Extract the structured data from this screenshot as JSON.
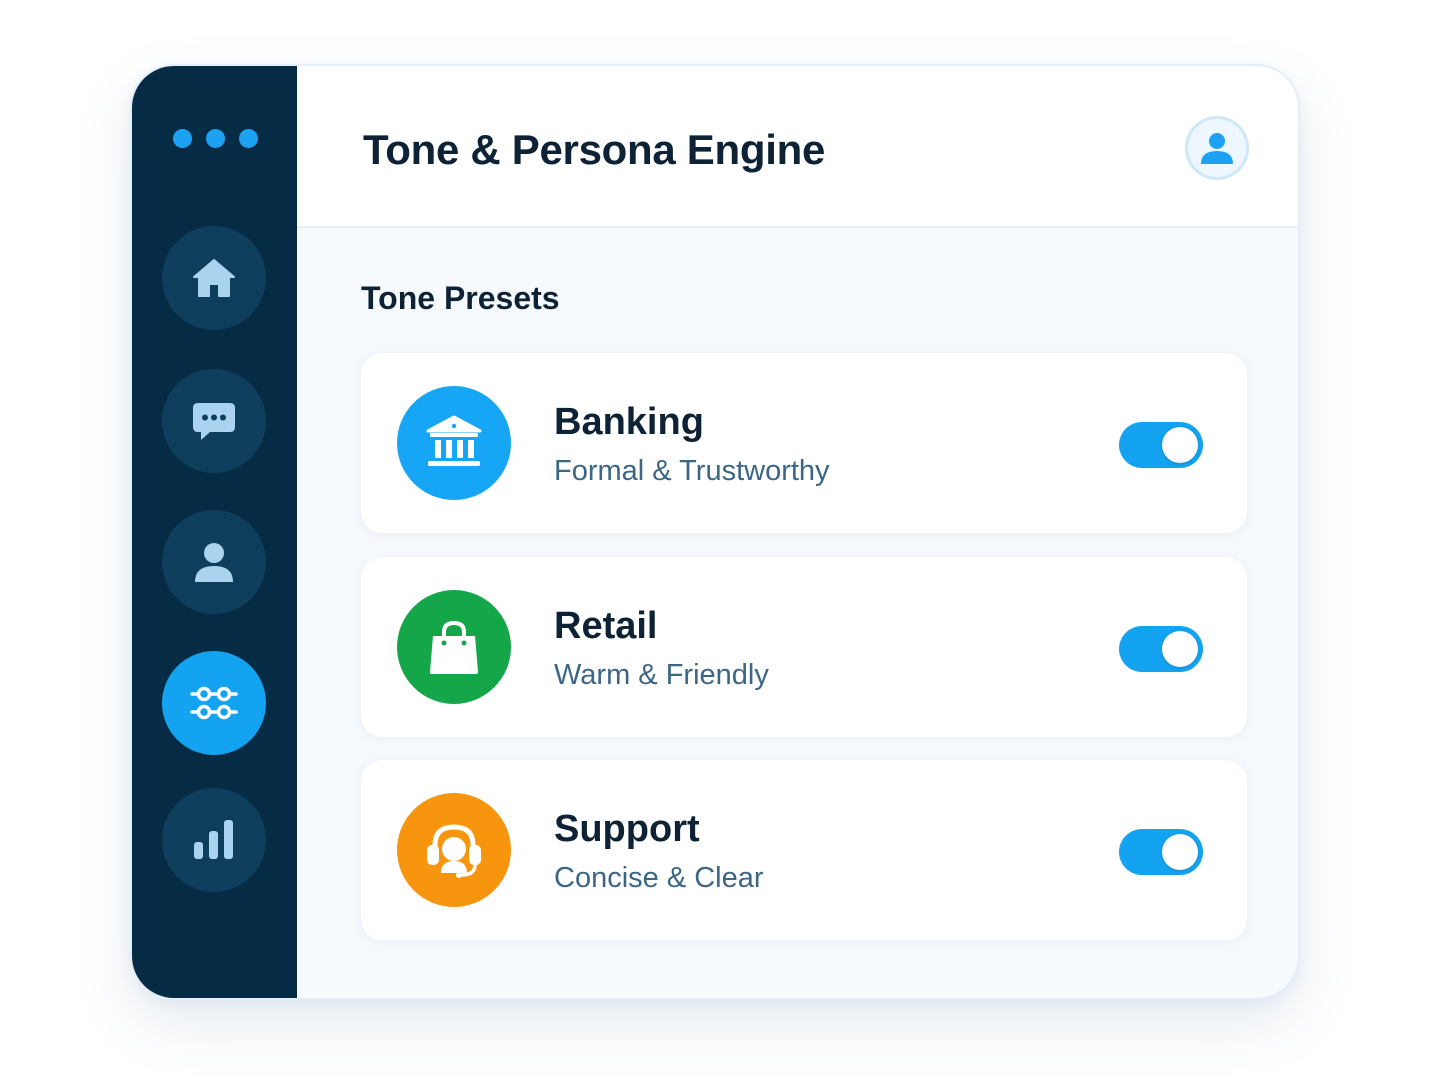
{
  "app": {
    "title": "Tone & Persona Engine",
    "accent_color": "#14a3f0",
    "sidebar_color": "#062c45"
  },
  "header": {
    "avatar_icon": "user-avatar-icon"
  },
  "sidebar": {
    "window_dots": [
      "dot-1",
      "dot-2",
      "dot-3"
    ],
    "items": [
      {
        "icon": "home-icon",
        "active": false
      },
      {
        "icon": "chat-icon",
        "active": false
      },
      {
        "icon": "user-icon",
        "active": false
      },
      {
        "icon": "sliders-icon",
        "active": true
      },
      {
        "icon": "bar-chart-icon",
        "active": false
      }
    ]
  },
  "main": {
    "section_title": "Tone Presets",
    "presets": [
      {
        "name": "Banking",
        "description": "Formal & Trustworthy",
        "icon": "bank-icon",
        "color": "#16a6f5",
        "enabled": true
      },
      {
        "name": "Retail",
        "description": "Warm & Friendly",
        "icon": "shopping-bag-icon",
        "color": "#16a64a",
        "enabled": true
      },
      {
        "name": "Support",
        "description": "Concise & Clear",
        "icon": "headset-icon",
        "color": "#f7950f",
        "enabled": true
      }
    ]
  }
}
